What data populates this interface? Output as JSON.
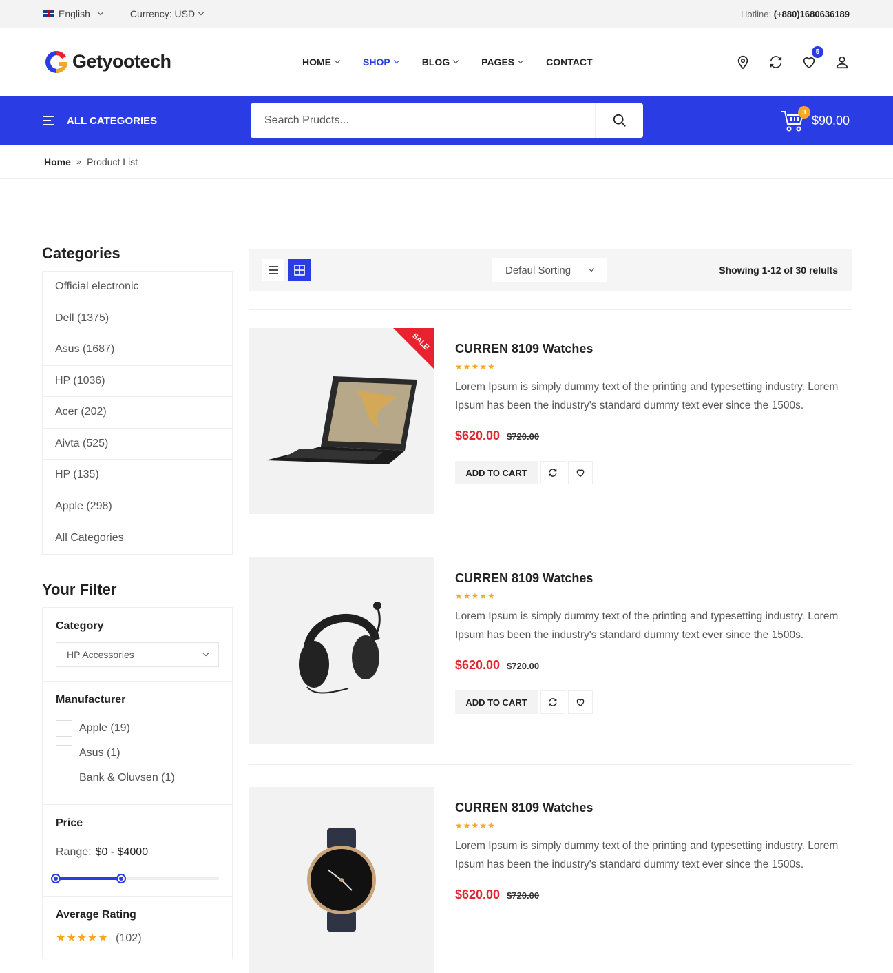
{
  "topbar": {
    "language": "English",
    "currency": "Currency: USD",
    "hotline_label": "Hotline:",
    "hotline_number": "(+880)1680636189"
  },
  "header": {
    "logo_text": "Getyootech",
    "nav": [
      {
        "label": "HOME",
        "active": false
      },
      {
        "label": "SHOP",
        "active": true
      },
      {
        "label": "BLOG",
        "active": false
      },
      {
        "label": "PAGES",
        "active": false
      },
      {
        "label": "CONTACT",
        "active": false
      }
    ],
    "wishlist_count": "5"
  },
  "bar": {
    "all_categories": "ALL CATEGORIES",
    "search_placeholder": "Search Prudcts...",
    "cart_count": "3",
    "cart_total": "$90.00"
  },
  "breadcrumb": {
    "home": "Home",
    "current": "Product List"
  },
  "sidebar": {
    "categories_title": "Categories",
    "categories": [
      "Official electronic",
      "Dell (1375)",
      "Asus (1687)",
      "HP (1036)",
      "Acer (202)",
      "Aivta (525)",
      "HP (135)",
      "Apple (298)",
      "All Categories"
    ],
    "filter_title": "Your Filter",
    "category_label": "Category",
    "category_value": "HP Accessories",
    "manufacturer_label": "Manufacturer",
    "manufacturers": [
      "Apple (19)",
      "Asus (1)",
      "Bank & Oluvsen (1)"
    ],
    "price_label": "Price",
    "range_label": "Range:",
    "range_value": "$0 - $4000",
    "range_low_fraction": 0.0,
    "range_high_fraction": 0.4,
    "rating_label": "Average Rating",
    "rating_count": "(102)"
  },
  "toolbar": {
    "sort": "Defaul Sorting",
    "showing": "Showing 1-12 of 30 relults"
  },
  "products": [
    {
      "title": "CURREN 8109 Watches",
      "rating": 5,
      "desc": "Lorem Ipsum is simply dummy text of the printing and typesetting industry. Lorem Ipsum has been the industry's standard dummy text ever since the 1500s.",
      "price": "$620.00",
      "old_price": "$720.00",
      "sale": "SALE",
      "image": "laptop-image"
    },
    {
      "title": "CURREN 8109 Watches",
      "rating": 5,
      "desc": "Lorem Ipsum is simply dummy text of the printing and typesetting industry. Lorem Ipsum has been the industry's standard dummy text ever since the 1500s.",
      "price": "$620.00",
      "old_price": "$720.00",
      "image": "headphones-image"
    },
    {
      "title": "CURREN 8109 Watches",
      "rating": 5,
      "desc": "Lorem Ipsum is simply dummy text of the printing and typesetting industry. Lorem Ipsum has been the industry's standard dummy text ever since the 1500s.",
      "price": "$620.00",
      "old_price": "$720.00",
      "image": "watch-image"
    }
  ],
  "add_to_cart": "ADD TO CART",
  "colors": {
    "primary": "#2a3ce3",
    "price": "#e0262f",
    "star": "#f5a623",
    "sale": "#e8222e"
  }
}
